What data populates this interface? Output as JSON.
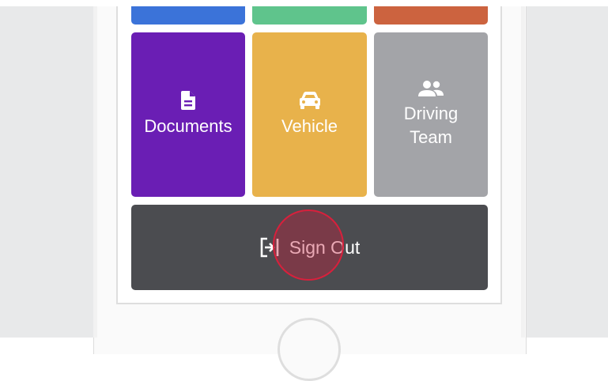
{
  "tiles_top_row": [
    {
      "id": "tile-blue",
      "color": "#3b73d9"
    },
    {
      "id": "tile-green",
      "color": "#5fc48c"
    },
    {
      "id": "tile-orange",
      "color": "#cc633f"
    }
  ],
  "tiles": {
    "documents": {
      "label": "Documents",
      "color": "#6a1eb4",
      "icon": "file-document-icon"
    },
    "vehicle": {
      "label": "Vehicle",
      "color": "#e8b24b",
      "icon": "car-icon"
    },
    "driving_team": {
      "label": "Driving\nTeam",
      "color": "#a3a4a8",
      "icon": "people-group-icon"
    }
  },
  "sign_out": {
    "label": "Sign Out",
    "color": "#4b4c50",
    "icon": "sign-out-icon"
  },
  "tap_marker": {
    "color": "#d8203c"
  }
}
